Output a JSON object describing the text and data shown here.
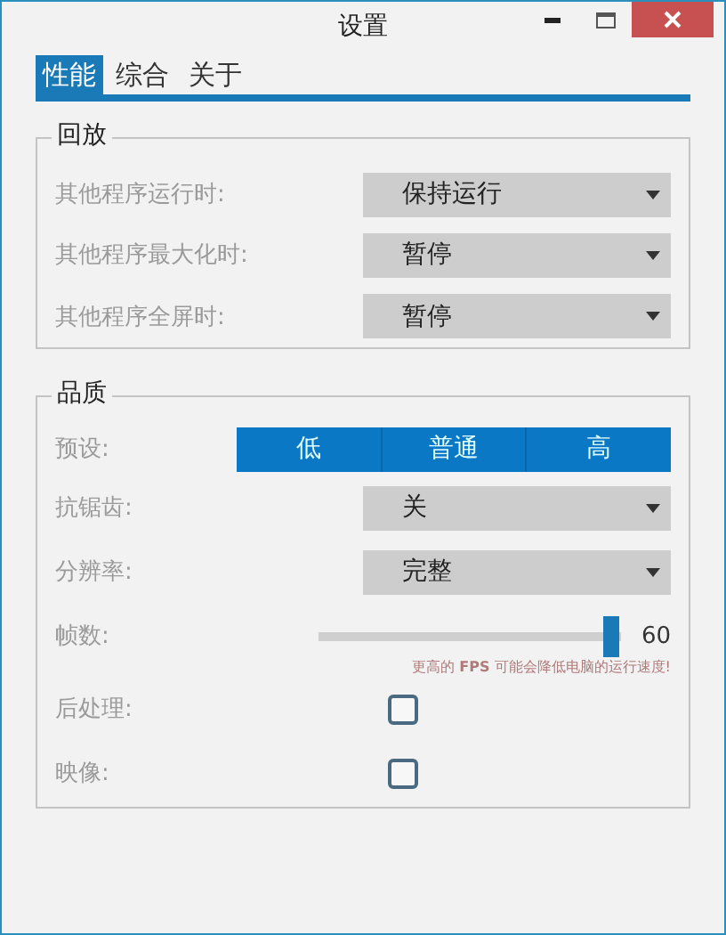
{
  "window": {
    "title": "设置"
  },
  "tabs": [
    {
      "label": "性能",
      "selected": true
    },
    {
      "label": "综合",
      "selected": false
    },
    {
      "label": "关于",
      "selected": false
    }
  ],
  "playback": {
    "title": "回放",
    "rows": [
      {
        "label": "其他程序运行时:",
        "value": "保持运行"
      },
      {
        "label": "其他程序最大化时:",
        "value": "暂停"
      },
      {
        "label": "其他程序全屏时:",
        "value": "暂停"
      }
    ]
  },
  "quality": {
    "title": "品质",
    "preset": {
      "label": "预设:",
      "options": [
        "低",
        "普通",
        "高"
      ]
    },
    "rows": [
      {
        "kind": "dropdown",
        "label": "抗锯齿:",
        "value": "关"
      },
      {
        "kind": "dropdown",
        "label": "分辨率:",
        "value": "完整"
      },
      {
        "kind": "slider",
        "label": "帧数:",
        "level": 0.97,
        "reading": "60",
        "note": "更高的 **FPS** 可能会降低电脑的运行速度!"
      },
      {
        "kind": "checkbox",
        "label": "后处理:",
        "checked": false
      },
      {
        "kind": "checkbox",
        "label": "映像:",
        "checked": false
      }
    ]
  }
}
